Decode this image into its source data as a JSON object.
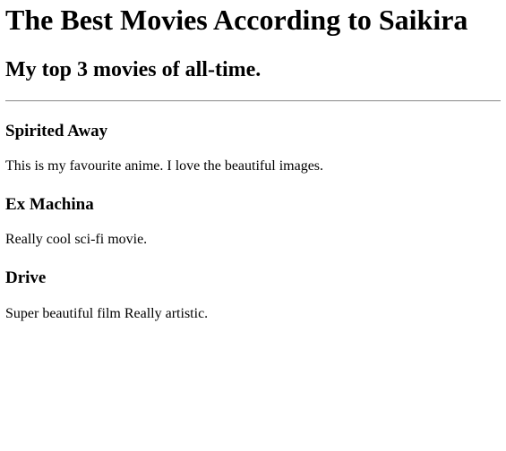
{
  "page": {
    "title": "The Best Movies According to Saikira",
    "subtitle": "My top 3 movies of all-time."
  },
  "movies": [
    {
      "title": "Spirited Away",
      "description": "This is my favourite anime. I love the beautiful images."
    },
    {
      "title": "Ex Machina",
      "description": "Really cool sci-fi movie."
    },
    {
      "title": "Drive",
      "description": "Super beautiful film Really artistic."
    }
  ]
}
